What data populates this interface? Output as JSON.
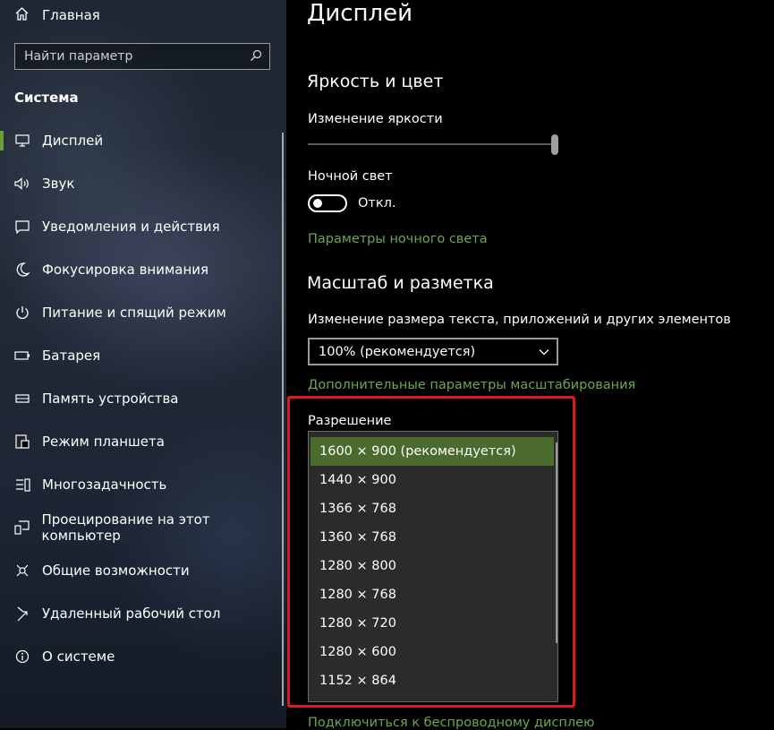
{
  "sidebar": {
    "home_label": "Главная",
    "search_placeholder": "Найти параметр",
    "section_title": "Система",
    "items": [
      {
        "label": "Дисплей",
        "icon": "monitor-icon"
      },
      {
        "label": "Звук",
        "icon": "speaker-icon"
      },
      {
        "label": "Уведомления и действия",
        "icon": "notification-icon"
      },
      {
        "label": "Фокусировка внимания",
        "icon": "moon-icon"
      },
      {
        "label": "Питание и спящий режим",
        "icon": "power-icon"
      },
      {
        "label": "Батарея",
        "icon": "battery-icon"
      },
      {
        "label": "Память устройства",
        "icon": "storage-icon"
      },
      {
        "label": "Режим планшета",
        "icon": "tablet-icon"
      },
      {
        "label": "Многозадачность",
        "icon": "multitasking-icon"
      },
      {
        "label": "Проецирование на этот компьютер",
        "icon": "projection-icon"
      },
      {
        "label": "Общие возможности",
        "icon": "shared-experiences-icon"
      },
      {
        "label": "Удаленный рабочий стол",
        "icon": "remote-desktop-icon"
      },
      {
        "label": "О системе",
        "icon": "info-icon"
      }
    ],
    "active_index": 0
  },
  "main": {
    "page_title": "Дисплей",
    "brightness_section": "Яркость и цвет",
    "brightness_label": "Изменение яркости",
    "brightness_level": 1.0,
    "night_light_label": "Ночной свет",
    "night_light_state": "Откл.",
    "night_light_settings_link": "Параметры ночного света",
    "scale_section": "Масштаб и разметка",
    "scale_label": "Изменение размера текста, приложений и других элементов",
    "scale_value": "100% (рекомендуется)",
    "advanced_scaling_link": "Дополнительные параметры масштабирования",
    "resolution_label": "Разрешение",
    "resolution_options": [
      "1600 × 900 (рекомендуется)",
      "1440 × 900",
      "1366 × 768",
      "1360 × 768",
      "1280 × 800",
      "1280 × 768",
      "1280 × 720",
      "1280 × 600",
      "1152 × 864"
    ],
    "resolution_selected_index": 0,
    "wireless_display_link": "Подключиться к беспроводному дисплею"
  },
  "colors": {
    "accent_green": "#6aa84f",
    "selected_bg": "#4b6b2c",
    "highlight_red": "#e0191c"
  }
}
